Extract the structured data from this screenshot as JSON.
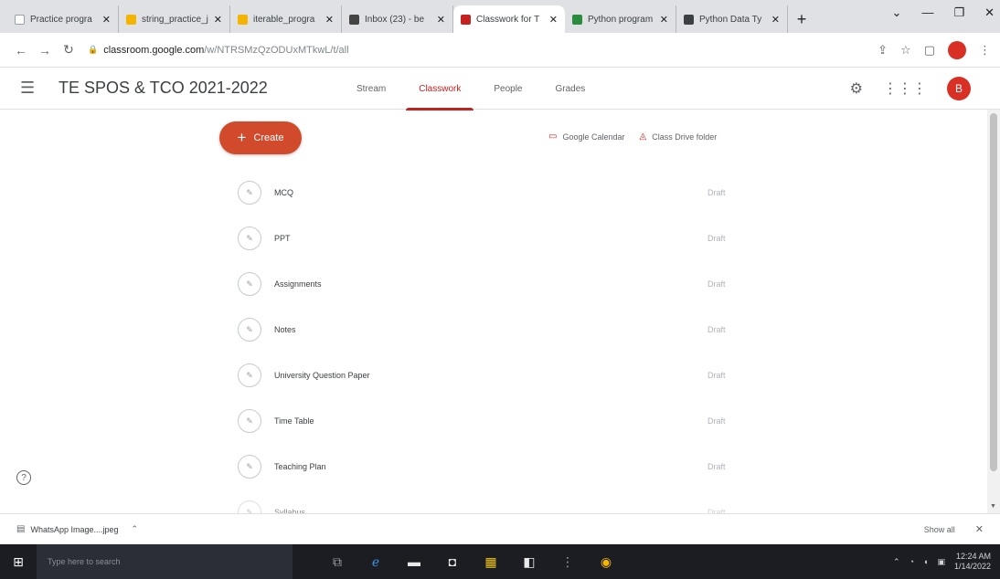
{
  "browser": {
    "tabs": [
      {
        "label": "Practice progra",
        "favicon_color": "#ffffff",
        "active": false
      },
      {
        "label": "string_practice_j",
        "favicon_color": "#f4b400",
        "active": false
      },
      {
        "label": "iterable_progra",
        "favicon_color": "#f4b400",
        "active": false
      },
      {
        "label": "Inbox (23) - be",
        "favicon_color": "#444444",
        "active": false
      },
      {
        "label": "Classwork for T",
        "favicon_color": "#c5221f",
        "active": true
      },
      {
        "label": "Python program",
        "favicon_color": "#2a8c3d",
        "active": false
      },
      {
        "label": "Python Data Ty",
        "favicon_color": "#3c4043",
        "active": false
      }
    ],
    "url_host": "classroom.google.com",
    "url_path": "/w/NTRSMzQzODUxMTkwL/t/all"
  },
  "header": {
    "title": "TE SPOS & TCO 2021-2022",
    "tabs": [
      {
        "label": "Stream",
        "active": false
      },
      {
        "label": "Classwork",
        "active": true
      },
      {
        "label": "People",
        "active": false
      },
      {
        "label": "Grades",
        "active": false
      }
    ],
    "avatar_letter": "B"
  },
  "toolbar": {
    "create_label": "Create",
    "calendar_label": "Google Calendar",
    "drive_label": "Class Drive folder"
  },
  "topics": [
    {
      "name": "MCQ",
      "status": "Draft"
    },
    {
      "name": "PPT",
      "status": "Draft"
    },
    {
      "name": "Assignments",
      "status": "Draft"
    },
    {
      "name": "Notes",
      "status": "Draft"
    },
    {
      "name": "University Question Paper",
      "status": "Draft"
    },
    {
      "name": "Time Table",
      "status": "Draft"
    },
    {
      "name": "Teaching Plan",
      "status": "Draft"
    },
    {
      "name": "Syllabus",
      "status": "Draft"
    }
  ],
  "downloads": {
    "file_name": "WhatsApp Image....jpeg",
    "show_all_label": "Show all"
  },
  "taskbar": {
    "search_placeholder": "Type here to search",
    "time": "12:24 AM",
    "date": "1/14/2022"
  },
  "colors": {
    "accent": "#c5221f",
    "create_button": "#d14a2c"
  }
}
